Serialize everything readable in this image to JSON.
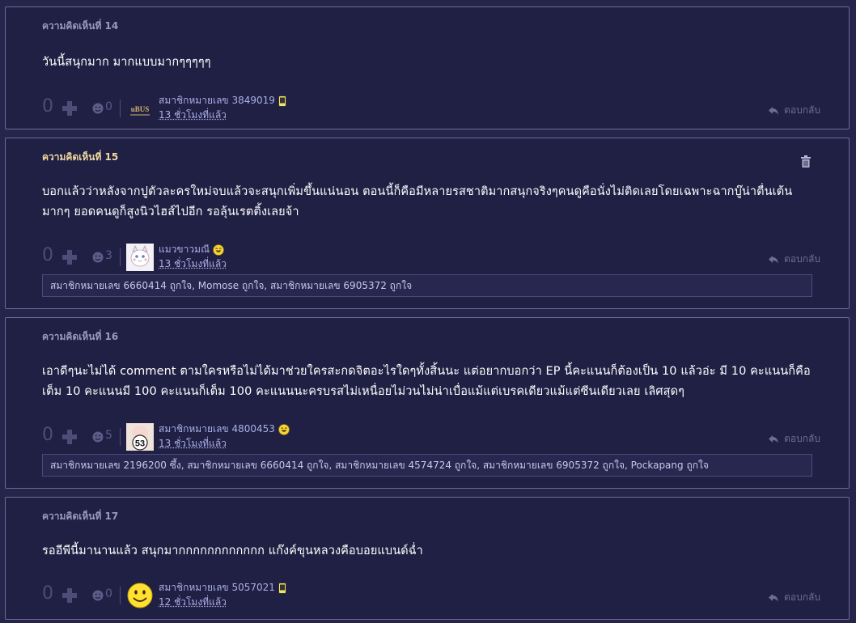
{
  "comments": [
    {
      "number": "ความคิดเห็นที่ 14",
      "text": "วันนี้สนุกมาก มากแบบมากๆๆๆๆๆ",
      "votes": "0",
      "emotion_count": "0",
      "author": "สมาชิกหมายเลข 3849019",
      "time": "13 ชั่วโมงที่แล้ว",
      "reply_label": "ตอบกลับ",
      "avatar": "logo-avatar",
      "badge": "phone-badge-icon"
    },
    {
      "number": "ความคิดเห็นที่ 15",
      "text": "บอกแล้วว่าหลังจากปูตัวละครใหม่จบแล้วจะสนุกเพิ่มขึ้นแน่นอน ตอนนี้ก็คือมีหลายรสชาติมากสนุกจริงๆคนดูคือนั่งไม่ติดเลยโดยเฉพาะฉากบู๊น่าตื่นเต้นมากๆ ยอดคนดูก็สูงนิวไฮส์ไปอีก รอลุ้นเรตติ้งเลยจ้า",
      "votes": "0",
      "emotion_count": "3",
      "author": "แมวขาวมณี",
      "time": "13 ชั่วโมงที่แล้ว",
      "reply_label": "ตอบกลับ",
      "avatar": "cat-avatar",
      "badge": "laugh-emoji-icon",
      "likes": "สมาชิกหมายเลข 6660414 ถูกใจ, Momose ถูกใจ, สมาชิกหมายเลข 6905372 ถูกใจ"
    },
    {
      "number": "ความคิดเห็นที่ 16",
      "text": "เอาดีๆนะไม่ได้ comment ตามใครหรือไม่ได้มาช่วยใครสะกดจิตอะไรใดๆทั้งสิ้นนะ แต่อยากบอกว่า EP นี้คะแนนก็ต้องเป็น 10 แล้วอ่ะ มี 10 คะแนนก็คือเต็ม 10 คะแนนมี 100 คะแนนก็เต็ม 100 คะแนนนะครบรสไม่เหนื่อยไม่วนไม่น่าเบื่อแม้แต่เบรคเดียวแม้แต่ซีนเดียวเลย เลิศสุดๆ",
      "votes": "0",
      "emotion_count": "5",
      "author": "สมาชิกหมายเลข 4800453",
      "time": "13 ชั่วโมงที่แล้ว",
      "reply_label": "ตอบกลับ",
      "avatar": "number-53-avatar",
      "avatar_text": "53",
      "badge": "laugh-emoji-icon",
      "likes": "สมาชิกหมายเลข 2196200 ซึ้ง, สมาชิกหมายเลข 6660414 ถูกใจ, สมาชิกหมายเลข 4574724 ถูกใจ, สมาชิกหมายเลข 6905372 ถูกใจ, Pockapang ถูกใจ"
    },
    {
      "number": "ความคิดเห็นที่ 17",
      "text": "รออีพีนี้มานานแล้ว สนุกมากกกกกกกกกกกก แก๊งค์ขุนหลวงคือบอยแบนด์ฉ่ำ",
      "votes": "0",
      "emotion_count": "0",
      "author": "สมาชิกหมายเลข 5057021",
      "time": "12 ชั่วโมงที่แล้ว",
      "reply_label": "ตอบกลับ",
      "avatar": "smiley-avatar",
      "badge": "phone-badge-icon"
    }
  ]
}
